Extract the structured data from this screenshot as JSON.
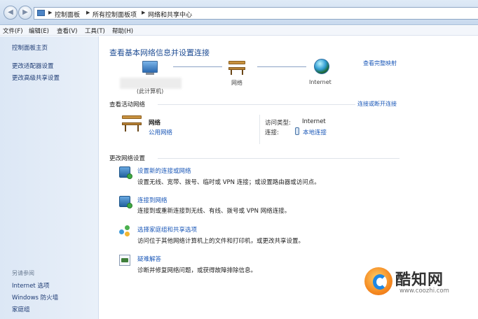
{
  "breadcrumb": [
    "控制面板",
    "所有控制面板项",
    "网络和共享中心"
  ],
  "menu": [
    "文件(F)",
    "编辑(E)",
    "查看(V)",
    "工具(T)",
    "帮助(H)"
  ],
  "sidebar": {
    "items": [
      {
        "label": "控制面板主页"
      },
      {
        "label": "更改适配器设置"
      },
      {
        "label": "更改高级共享设置"
      }
    ],
    "see_also_title": "另请参阅",
    "see_also": [
      {
        "label": "Internet 选项"
      },
      {
        "label": "Windows 防火墙"
      },
      {
        "label": "家庭组"
      }
    ]
  },
  "main": {
    "title": "查看基本网络信息并设置连接",
    "view_full_map": "查看完整映射",
    "network_map": {
      "this_pc": "(此计算机)",
      "network": "网络",
      "internet": "Internet"
    },
    "active_networks": {
      "title": "查看活动网络",
      "connect_disconnect": "连接或断开连接",
      "network_name": "网络",
      "network_type": "公用网络",
      "access_type_label": "访问类型:",
      "access_type_value": "Internet",
      "connection_label": "连接:",
      "connection_value": "本地连接"
    },
    "change_settings": {
      "title": "更改网络设置",
      "tasks": [
        {
          "icon": "network-setup-icon",
          "link": "设置新的连接或网络",
          "desc": "设置无线、宽带、拨号、临时或 VPN 连接；或设置路由器或访问点。"
        },
        {
          "icon": "connect-network-icon",
          "link": "连接到网络",
          "desc": "连接到或重新连接到无线、有线、拨号或 VPN 网络连接。"
        },
        {
          "icon": "homegroup-icon",
          "link": "选择家庭组和共享选项",
          "desc": "访问位于其他网络计算机上的文件和打印机，或更改共享设置。"
        },
        {
          "icon": "troubleshoot-icon",
          "link": "疑难解答",
          "desc": "诊断并修复网络问题，或获得故障排除信息。"
        }
      ]
    }
  },
  "watermark": {
    "title": "酷知网",
    "url": "www.coozhi.com"
  },
  "colors": {
    "link": "#1b58b8",
    "heading": "#1f4d94",
    "sidebar_bg": "#dce7f5"
  }
}
